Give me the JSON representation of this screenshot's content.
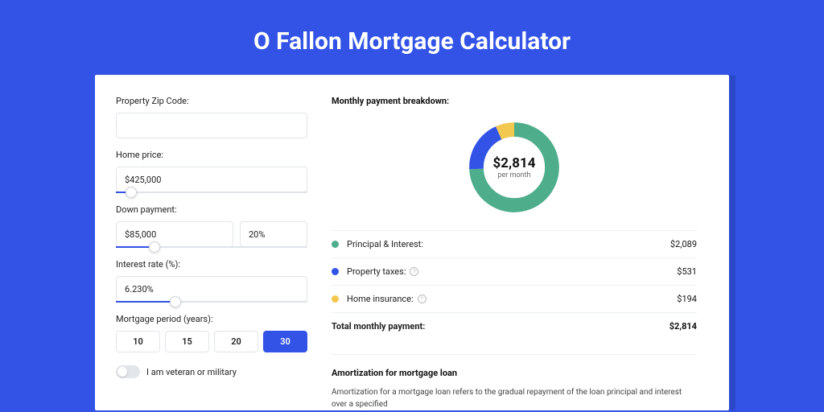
{
  "title": "O Fallon Mortgage Calculator",
  "form": {
    "zip_label": "Property Zip Code:",
    "zip_value": "",
    "home_price_label": "Home price:",
    "home_price_value": "$425,000",
    "home_price_slider_pct": 8,
    "down_payment_label": "Down payment:",
    "down_payment_value": "$85,000",
    "down_payment_pct": "20%",
    "down_payment_slider_pct": 20,
    "interest_label": "Interest rate (%):",
    "interest_value": "6.230%",
    "interest_slider_pct": 31,
    "period_label": "Mortgage period (years):",
    "periods": [
      "10",
      "15",
      "20",
      "30"
    ],
    "period_active": "30",
    "veteran_label": "I am veteran or military"
  },
  "breakdown": {
    "heading": "Monthly payment breakdown:",
    "total_amount": "$2,814",
    "total_sub": "per month",
    "rows": [
      {
        "label": "Principal & Interest:",
        "value": "$2,089",
        "color": "#4eae8b",
        "info": false
      },
      {
        "label": "Property taxes:",
        "value": "$531",
        "color": "#3253e6",
        "info": true
      },
      {
        "label": "Home insurance:",
        "value": "$194",
        "color": "#f3c84f",
        "info": true
      }
    ],
    "total_label": "Total monthly payment:",
    "total_value": "$2,814"
  },
  "amort": {
    "title": "Amortization for mortgage loan",
    "body": "Amortization for a mortgage loan refers to the gradual repayment of the loan principal and interest over a specified"
  },
  "chart_data": {
    "type": "pie",
    "title": "Monthly payment breakdown",
    "series": [
      {
        "name": "Principal & Interest",
        "value": 2089,
        "color": "#4eae8b"
      },
      {
        "name": "Property taxes",
        "value": 531,
        "color": "#3253e6"
      },
      {
        "name": "Home insurance",
        "value": 194,
        "color": "#f3c84f"
      }
    ],
    "total": 2814,
    "unit": "USD per month"
  }
}
